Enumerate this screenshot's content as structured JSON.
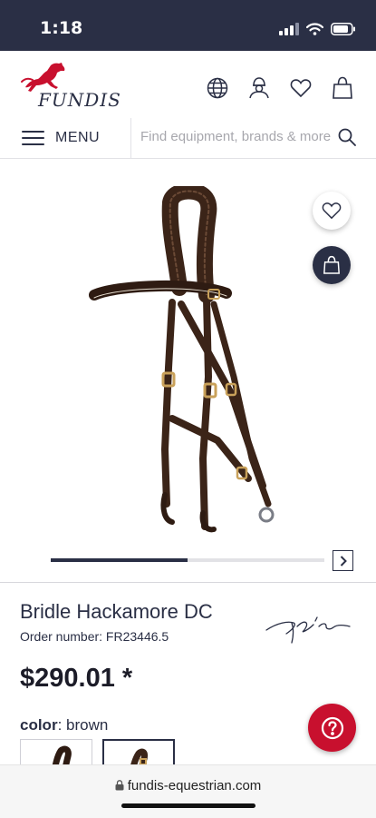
{
  "status_bar": {
    "time": "1:18"
  },
  "brand": {
    "name": "FUNDIS",
    "accent": "#c8102e",
    "dark": "#2a2f45"
  },
  "header": {
    "icons": [
      "globe-icon",
      "account-icon",
      "heart-icon",
      "bag-icon"
    ]
  },
  "menu": {
    "label": "MENU"
  },
  "search": {
    "placeholder": "Find equipment, brands & more"
  },
  "gallery": {
    "progress": 0.5
  },
  "product": {
    "title": "Bridle Hackamore DC",
    "order_number": "Order number: FR23446.5",
    "price": "$290.01 *",
    "color_label": "color",
    "color_value": ": brown",
    "swatch_count": 2
  },
  "browser": {
    "url": "fundis-equestrian.com"
  }
}
